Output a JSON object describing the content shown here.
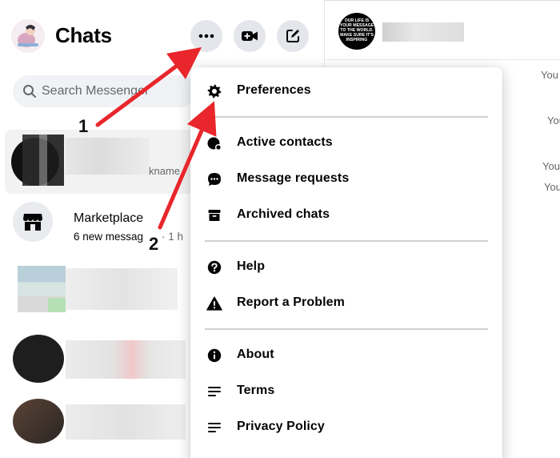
{
  "header": {
    "title": "Chats",
    "more_icon": "more-horizontal-icon",
    "video_icon": "video-call-icon",
    "compose_icon": "compose-icon"
  },
  "search": {
    "placeholder": "Search Messenger"
  },
  "chat_list": {
    "row1_fragment": "kname",
    "marketplace": {
      "name": "Marketplace",
      "subtitle": "6 new messag",
      "time": "· 1 h"
    }
  },
  "menu": {
    "items": [
      {
        "label": "Preferences",
        "icon": "gear-icon"
      },
      {
        "label": "Active contacts",
        "icon": "active-contacts-icon"
      },
      {
        "label": "Message requests",
        "icon": "chat-bubble-icon"
      },
      {
        "label": "Archived chats",
        "icon": "archive-icon"
      },
      {
        "label": "Help",
        "icon": "help-icon"
      },
      {
        "label": "Report a Problem",
        "icon": "warning-icon"
      },
      {
        "label": "About",
        "icon": "info-icon"
      },
      {
        "label": "Terms",
        "icon": "document-lines-icon"
      },
      {
        "label": "Privacy Policy",
        "icon": "document-lines-icon"
      }
    ]
  },
  "conversation": {
    "avatar_text": "OUR LIFE IS YOUR MESSAGE TO THE WORLD. MAKE SURE IT'S INSPIRING",
    "you_labels": [
      "You",
      "You",
      "You",
      "You"
    ]
  },
  "annotations": {
    "step1": "1",
    "step2": "2",
    "arrow_color": "#e8262b"
  },
  "colors": {
    "accent_gray": "#e4e6eb",
    "text_primary": "#050505",
    "text_secondary": "#65676b"
  }
}
